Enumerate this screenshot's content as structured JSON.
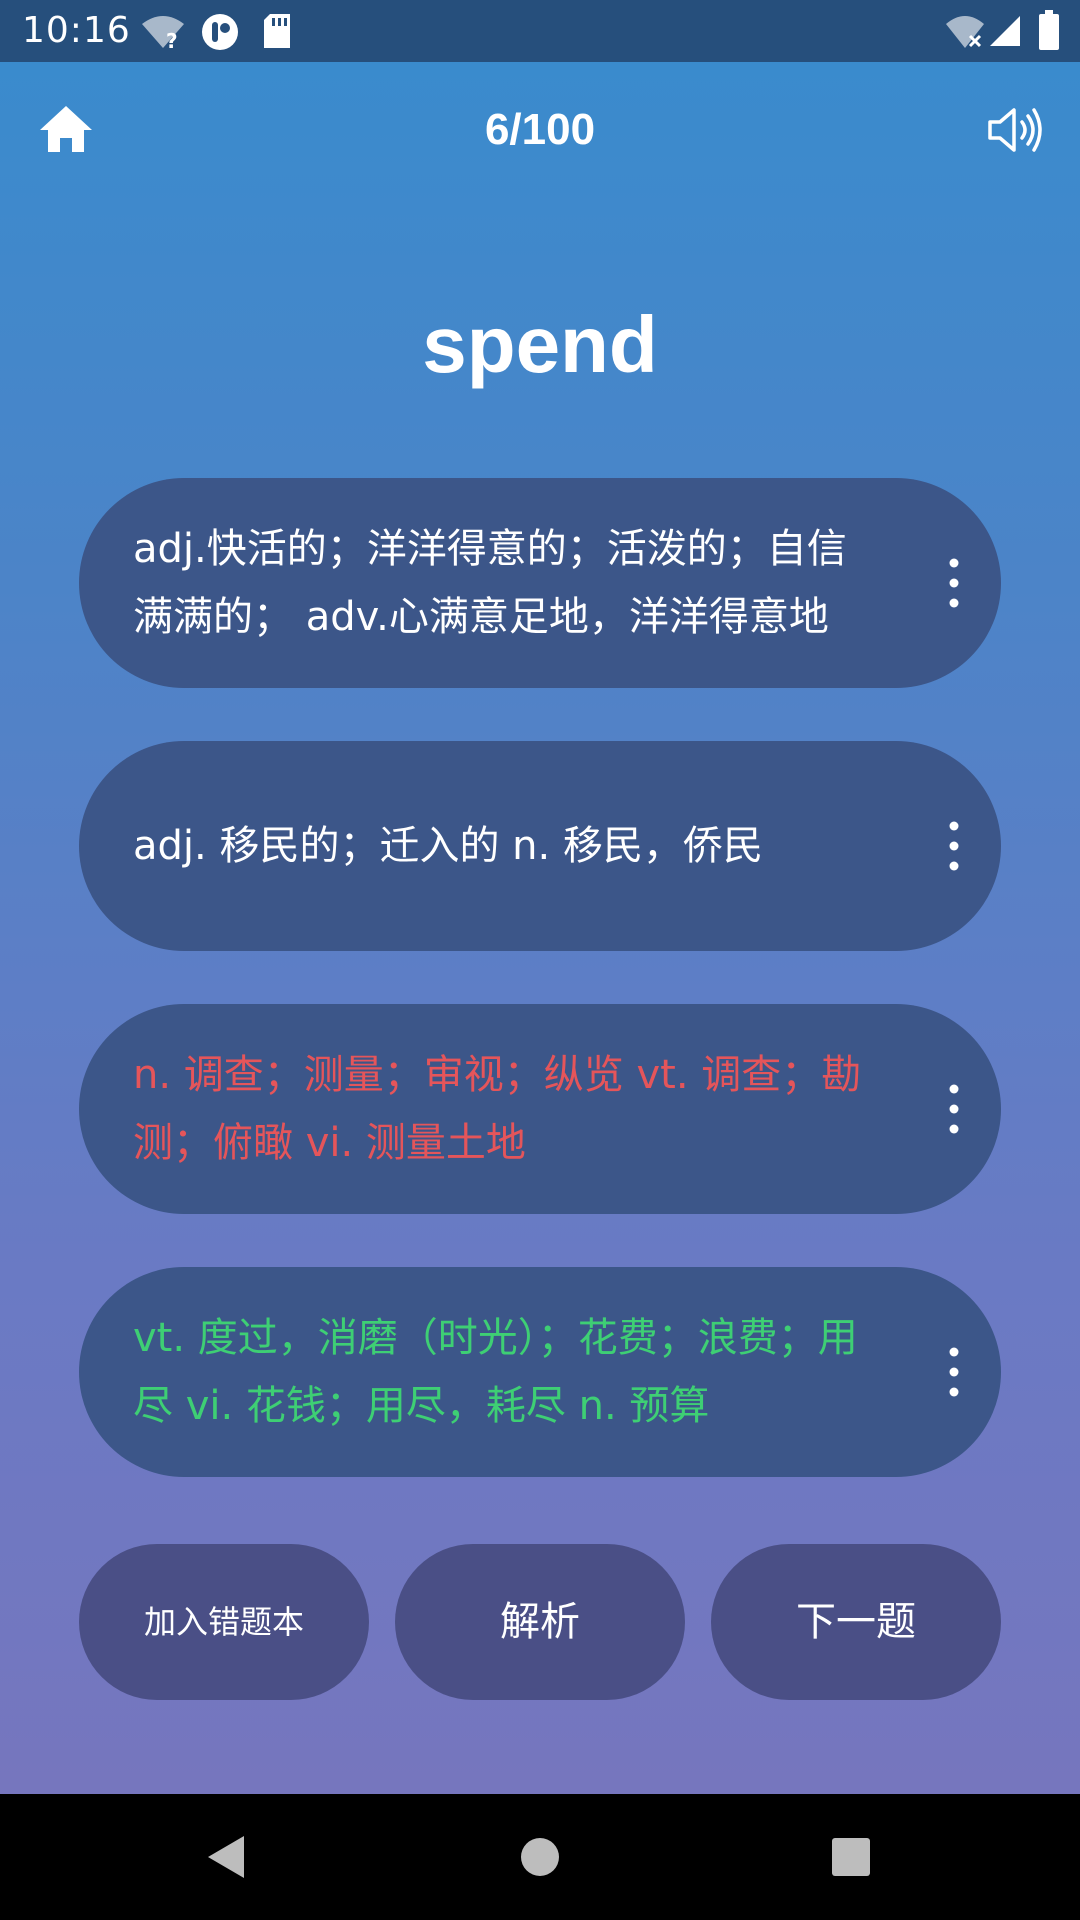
{
  "status_bar": {
    "time": "10:16",
    "icons": [
      "wifi-unknown-icon",
      "app-notification-icon",
      "sd-card-icon",
      "wifi-off-icon",
      "signal-icon",
      "battery-icon"
    ]
  },
  "header": {
    "home_icon": "home-icon",
    "counter": "6/100",
    "speaker_icon": "speaker-icon"
  },
  "question": {
    "word": "spend"
  },
  "options": [
    {
      "text": "adj.快活的；洋洋得意的；活泼的；自信满满的； adv.心满意足地，洋洋得意地",
      "state": "normal"
    },
    {
      "text": "adj. 移民的；迁入的 n. 移民，侨民",
      "state": "normal"
    },
    {
      "text": "n. 调查；测量；审视；纵览 vt. 调查；勘测；俯瞰 vi. 测量土地",
      "state": "wrong"
    },
    {
      "text": "vt. 度过，消磨（时光）；花费；浪费；用尽 vi. 花钱；用尽，耗尽 n. 预算",
      "state": "correct"
    }
  ],
  "actions": {
    "add_wrong_book": "加入错题本",
    "analysis": "解析",
    "next": "下一题"
  },
  "nav": {
    "icons": [
      "back-icon",
      "home-circle-icon",
      "recents-icon"
    ]
  },
  "colors": {
    "status_bar": "#264f7c",
    "option_bg": "#3c5689",
    "button_bg": "#4a4f86",
    "wrong": "#e5555a",
    "correct": "#3ecf74"
  }
}
